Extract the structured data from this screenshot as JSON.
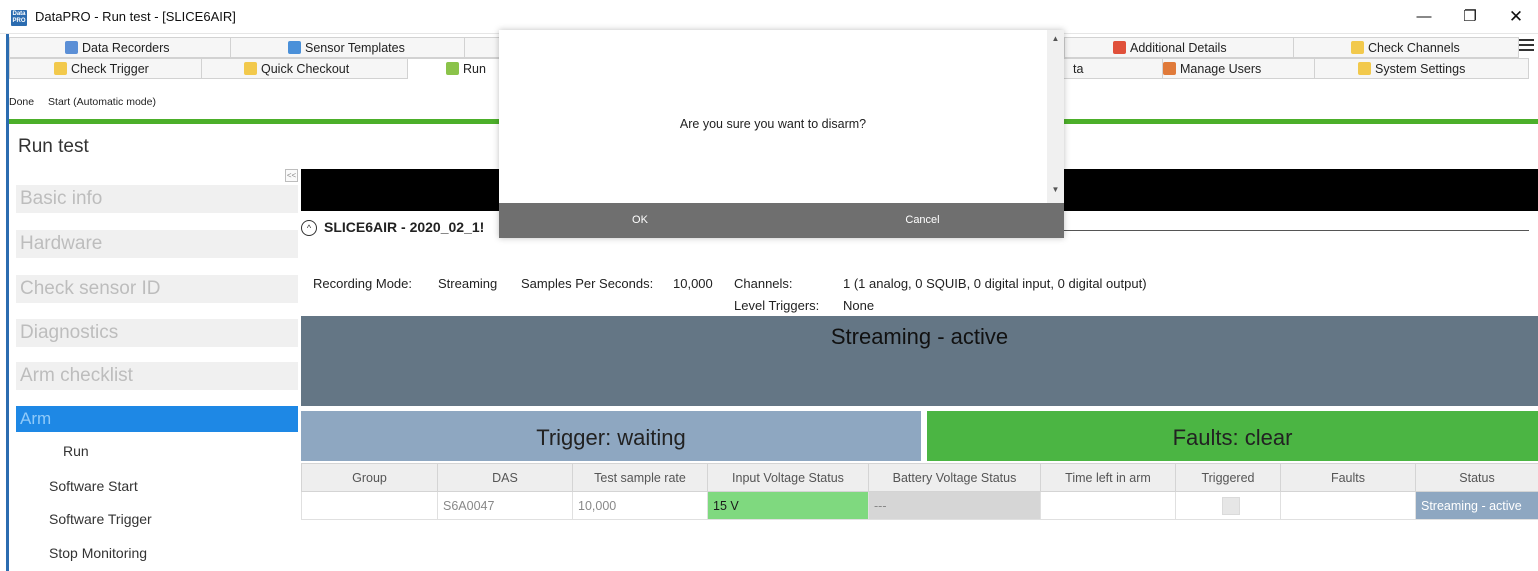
{
  "window": {
    "icon_text": "Data PRO",
    "title": "DataPRO  - Run test - [SLICE6AIR]",
    "min_glyph": "—",
    "max_glyph": "❐",
    "close_glyph": "✕"
  },
  "tabs_row1": [
    {
      "label": "Data Recorders",
      "icon": "recorder-icon",
      "color": "#5b8fd6"
    },
    {
      "label": "Sensor Templates",
      "icon": "template-icon",
      "color": "#4a90d9"
    },
    {
      "label": "Additional Details",
      "icon": "details-icon",
      "color": "#e0503a"
    },
    {
      "label": "Check Channels",
      "icon": "channels-icon",
      "color": "#f2c94c"
    }
  ],
  "tabs_row2": [
    {
      "label": "Check Trigger",
      "icon": "trigger-icon",
      "color": "#f2c94c"
    },
    {
      "label": "Quick Checkout",
      "icon": "checkout-icon",
      "color": "#f2c94c"
    },
    {
      "label": "Run",
      "icon": "run-icon",
      "color": "#8bc34a"
    },
    {
      "label": "ta",
      "icon": "",
      "color": ""
    },
    {
      "label": "Manage Users",
      "icon": "users-icon",
      "color": "#e07a3a"
    },
    {
      "label": "System Settings",
      "icon": "settings-icon",
      "color": "#f2c94c"
    }
  ],
  "toolbar": {
    "done": "Done",
    "start": "Start (Automatic mode)"
  },
  "page_title": "Run test",
  "collapse_glyph": "<<",
  "nav": {
    "items": [
      "Basic info",
      "Hardware",
      "Check sensor ID",
      "Diagnostics",
      "Arm checklist",
      "Arm"
    ],
    "subitems": [
      "Run",
      "Software Start",
      "Software Trigger",
      "Stop Monitoring"
    ]
  },
  "section": {
    "chevron": "^",
    "title": "SLICE6AIR - 2020_02_1!"
  },
  "info": {
    "recording_mode_label": "Recording Mode:",
    "recording_mode_value": "Streaming",
    "sps_label": "Samples Per Seconds:",
    "sps_value": "10,000",
    "channels_label": "Channels:",
    "channels_value": "1 (1  analog, 0 SQUIB, 0 digital input, 0 digital output)",
    "level_triggers_label": "Level Triggers:",
    "level_triggers_value": "None"
  },
  "status": {
    "streaming": "Streaming - active",
    "trigger": "Trigger: waiting",
    "faults": "Faults: clear"
  },
  "table": {
    "headers": [
      "Group",
      "DAS",
      "Test sample rate",
      "Input Voltage Status",
      "Battery Voltage Status",
      "Time left in arm",
      "Triggered",
      "Faults",
      "Status"
    ],
    "rows": [
      {
        "group": "",
        "das": "S6A0047",
        "rate": "10,000",
        "input_voltage": "15 V",
        "battery_voltage": "---",
        "time_left": "",
        "faults": "",
        "status": "Streaming - active"
      }
    ]
  },
  "dialog": {
    "message": "Are you sure you want to disarm?",
    "ok": "OK",
    "cancel": "Cancel",
    "scroll_up": "▲",
    "scroll_down": "▼"
  },
  "colors": {
    "accent_green": "#4caf2a",
    "streaming_bg": "#647685",
    "trigger_bg": "#8ea7c1",
    "faults_bg": "#4bb543",
    "nav_active": "#1e88e5"
  }
}
